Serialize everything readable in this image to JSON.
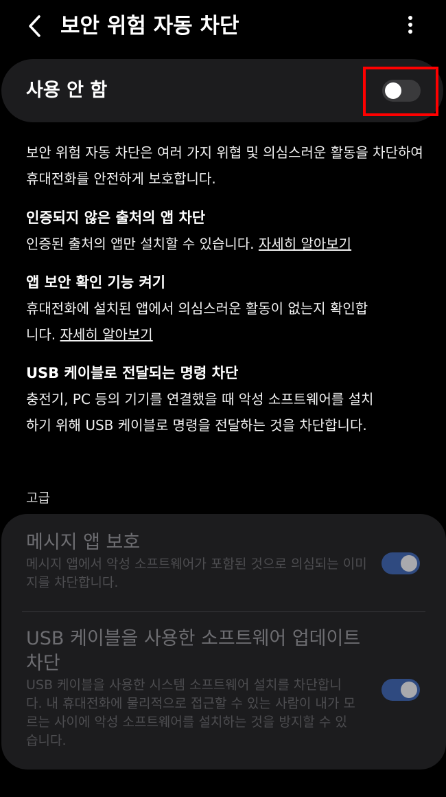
{
  "header": {
    "title": "보안 위험 자동 차단"
  },
  "master": {
    "label": "사용 안 함",
    "enabled": false
  },
  "description": "보안 위험 자동 차단은 여러 가지 위협 및 의심스러운 활동을 차단하여 휴대전화를 안전하게 보호합니다.",
  "features": [
    {
      "title": "인증되지 않은 출처의 앱 차단",
      "body": "인증된 출처의 앱만 설치할 수 있습니다.",
      "link": "자세히 알아보기"
    },
    {
      "title": "앱 보안 확인 기능 켜기",
      "body": "휴대전화에 설치된 앱에서 의심스러운 활동이 없는지 확인합니다.",
      "link": "자세히 알아보기"
    },
    {
      "title": "USB 케이블로 전달되는 명령 차단",
      "body": "충전기, PC 등의 기기를 연결했을 때 악성 소프트웨어를 설치하기 위해 USB 케이블로 명령을 전달하는 것을 차단합니다."
    }
  ],
  "advanced": {
    "header": "고급",
    "items": [
      {
        "title": "메시지 앱 보호",
        "subtitle": "메시지 앱에서 악성 소프트웨어가 포함된 것으로 의심되는 이미지를 차단합니다.",
        "enabled": true
      },
      {
        "title": "USB 케이블을 사용한 소프트웨어 업데이트 차단",
        "subtitle": "USB 케이블을 사용한 시스템 소프트웨어 설치를 차단합니다. 내 휴대전화에 물리적으로 접근할 수 있는 사람이 내가 모르는 사이에 악성 소프트웨어를 설치하는 것을 방지할 수 있습니다.",
        "enabled": true
      }
    ]
  },
  "icons": {
    "back": "chevron-left-icon",
    "more": "more-vertical-icon"
  },
  "colors": {
    "background": "#000000",
    "card": "#1c1c1e",
    "highlight": "#ff0000",
    "switch_on_track": "#2f4a80",
    "disabled_text": "#6d6d71"
  }
}
